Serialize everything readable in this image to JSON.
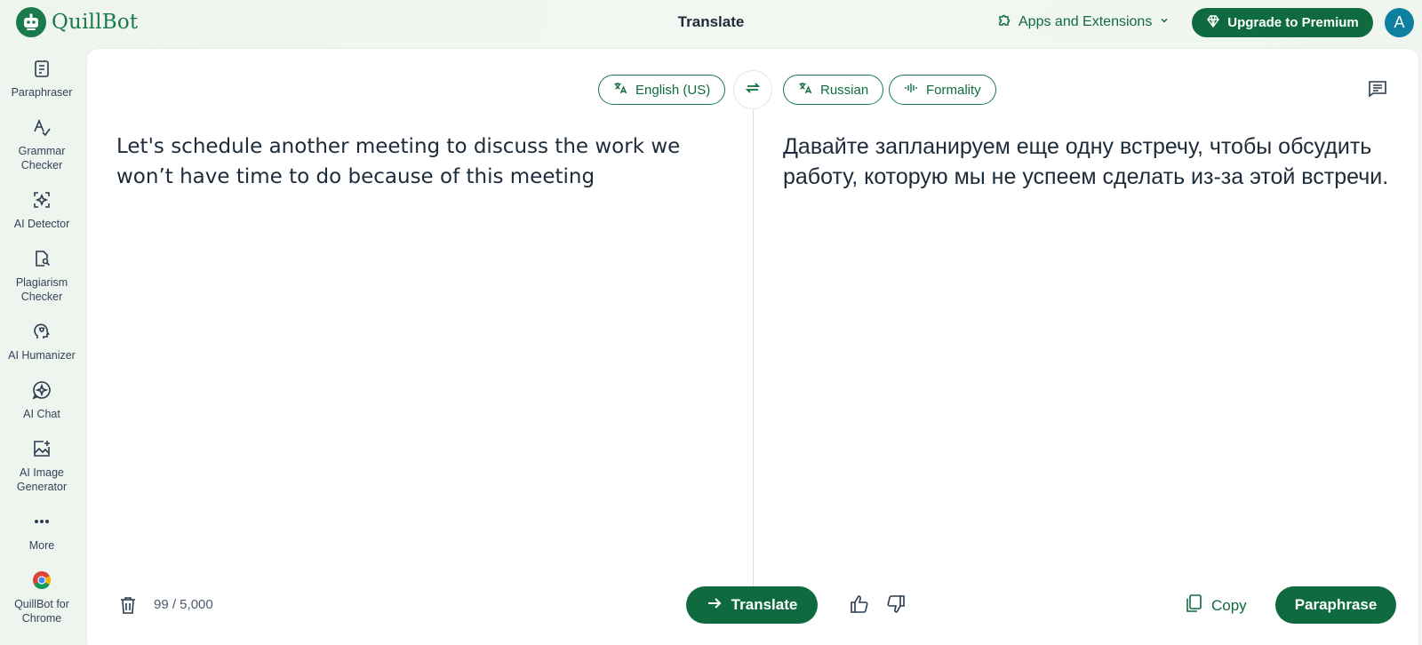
{
  "header": {
    "logo_text": "QuillBot",
    "page_title": "Translate",
    "apps_label": "Apps and Extensions",
    "upgrade_label": "Upgrade to Premium",
    "avatar_initial": "A"
  },
  "sidebar": {
    "items": [
      {
        "label": "Paraphraser",
        "icon": "paraphraser-icon"
      },
      {
        "label": "Grammar Checker",
        "icon": "grammar-checker-icon"
      },
      {
        "label": "AI Detector",
        "icon": "ai-detector-icon"
      },
      {
        "label": "Plagiarism Checker",
        "icon": "plagiarism-checker-icon"
      },
      {
        "label": "AI Humanizer",
        "icon": "ai-humanizer-icon"
      },
      {
        "label": "AI Chat",
        "icon": "ai-chat-icon"
      },
      {
        "label": "AI Image Generator",
        "icon": "ai-image-generator-icon"
      },
      {
        "label": "More",
        "icon": "more-icon"
      },
      {
        "label": "QuillBot for Chrome",
        "icon": "chrome-icon"
      }
    ]
  },
  "translator": {
    "source_language": "English (US)",
    "target_language": "Russian",
    "formality_label": "Formality",
    "source_text": "Let's schedule another meeting to discuss the work we won’t have time to do because of this meeting",
    "target_text": "Давайте запланируем еще одну встречу, чтобы обсудить работу, которую мы не успеем сделать из-за этой встречи.",
    "char_count": "99 / 5,000",
    "translate_label": "Translate",
    "copy_label": "Copy",
    "paraphrase_label": "Paraphrase"
  },
  "colors": {
    "brand_green": "#0f6b3f",
    "avatar_blue": "#0f7fa0"
  }
}
